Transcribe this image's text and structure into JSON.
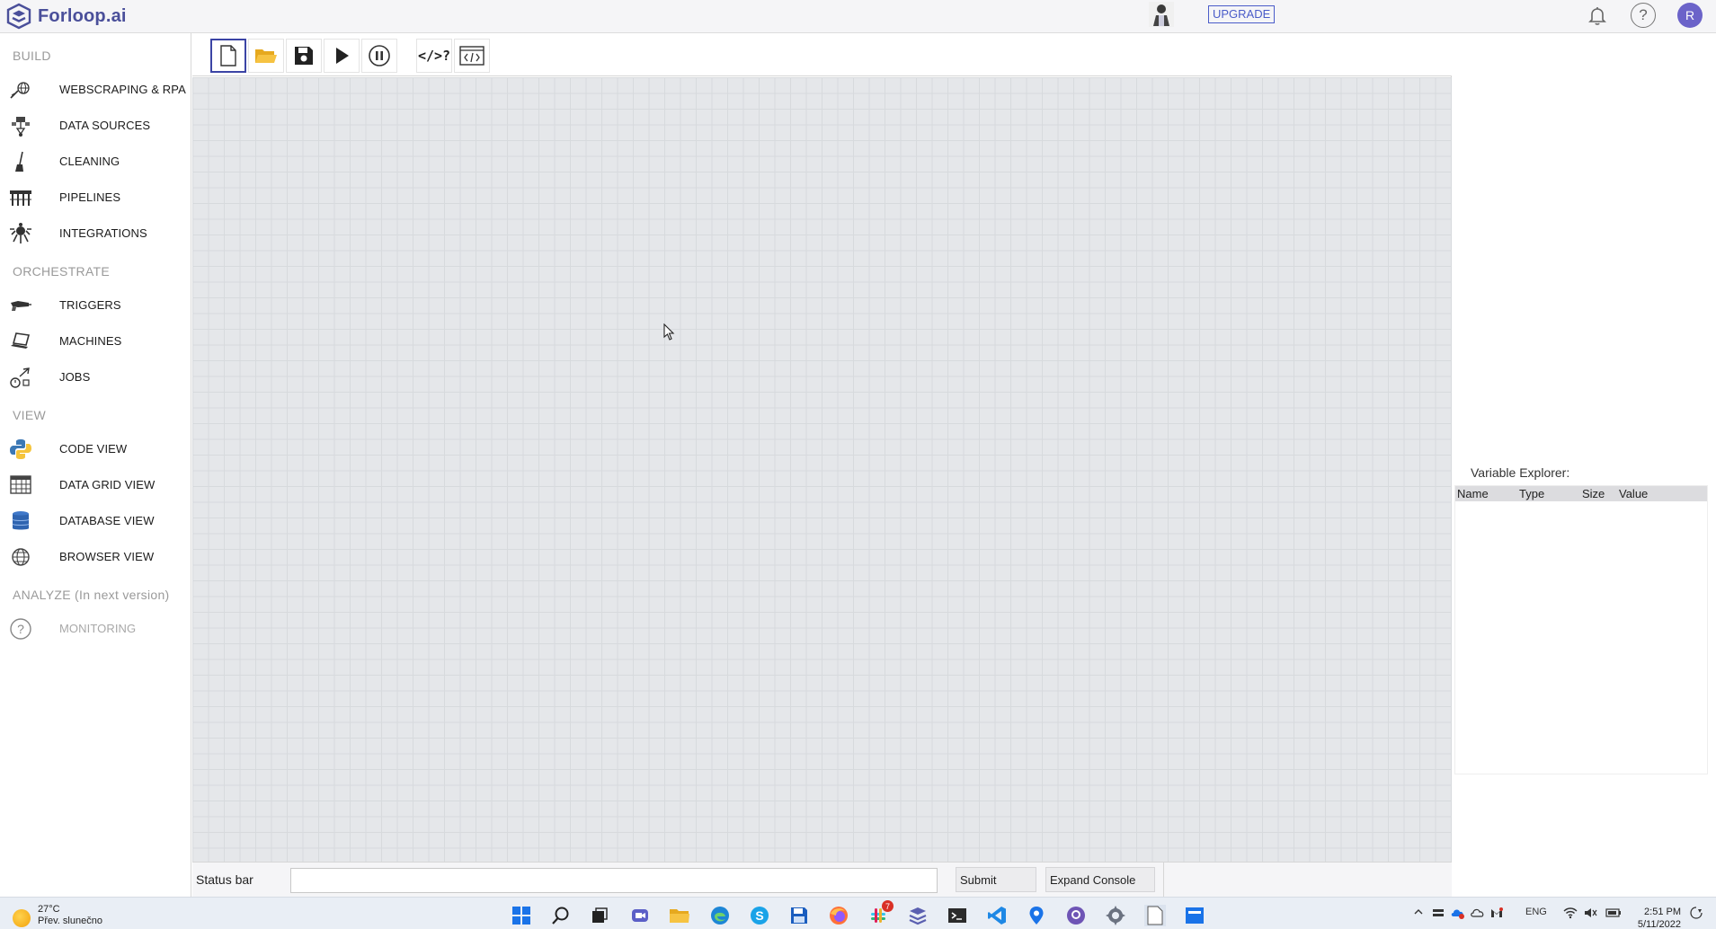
{
  "app": {
    "name": "Forloop.ai",
    "upgrade_label": "UPGRADE",
    "user_initial": "R"
  },
  "sidebar": {
    "sections": [
      {
        "title": "BUILD",
        "items": [
          {
            "label": "WEBSCRAPING & RPA",
            "icon": "webscraping-icon"
          },
          {
            "label": "DATA SOURCES",
            "icon": "data-sources-icon"
          },
          {
            "label": "CLEANING",
            "icon": "broom-icon"
          },
          {
            "label": "PIPELINES",
            "icon": "pipelines-icon"
          },
          {
            "label": "INTEGRATIONS",
            "icon": "integrations-icon"
          }
        ]
      },
      {
        "title": "ORCHESTRATE",
        "items": [
          {
            "label": "TRIGGERS",
            "icon": "trigger-icon"
          },
          {
            "label": "MACHINES",
            "icon": "laptop-icon"
          },
          {
            "label": "JOBS",
            "icon": "jobs-icon"
          }
        ]
      },
      {
        "title": "VIEW",
        "items": [
          {
            "label": "CODE VIEW",
            "icon": "python-icon"
          },
          {
            "label": "DATA GRID VIEW",
            "icon": "grid-icon"
          },
          {
            "label": "DATABASE VIEW",
            "icon": "database-icon"
          },
          {
            "label": "BROWSER VIEW",
            "icon": "globe-icon"
          }
        ]
      },
      {
        "title": "ANALYZE (In next version)",
        "items": [
          {
            "label": "MONITORING",
            "icon": "question-icon"
          }
        ]
      }
    ]
  },
  "toolbar": {
    "buttons": [
      {
        "name": "new-file",
        "icon": "new-file-icon",
        "active": true
      },
      {
        "name": "open-folder",
        "icon": "folder-icon"
      },
      {
        "name": "save",
        "icon": "floppy-icon"
      },
      {
        "name": "run",
        "icon": "play-icon"
      },
      {
        "name": "pause",
        "icon": "pause-icon"
      },
      {
        "name": "code-help",
        "icon": "code-question-icon",
        "glyph": "</>?"
      },
      {
        "name": "code-window",
        "icon": "code-window-icon"
      }
    ]
  },
  "statusbar": {
    "label": "Status bar",
    "input_value": "",
    "submit_label": "Submit",
    "expand_console_label": "Expand Console"
  },
  "variable_explorer": {
    "title": "Variable Explorer:",
    "columns": [
      "Name",
      "Type",
      "Size",
      "Value"
    ],
    "rows": []
  },
  "taskbar": {
    "weather_temp": "27°C",
    "weather_desc": "Přev. slunečno",
    "apps": [
      "windows-start-icon",
      "search-icon",
      "task-view-icon",
      "teams-icon",
      "file-explorer-icon",
      "edge-icon",
      "skype-icon",
      "save-app-icon",
      "firefox-icon",
      "slack-icon",
      "forloop-icon",
      "terminal-icon",
      "vscode-icon",
      "maps-icon",
      "github-icon",
      "settings-icon",
      "notepad-icon",
      "app-window-icon"
    ],
    "slack_badge": "7",
    "language": "ENG",
    "time": "2:51 PM",
    "date": "5/11/2022"
  },
  "colors": {
    "brand": "#4a4f9a",
    "accent": "#3b44a5",
    "canvas_bg": "#e5e7ea",
    "grid_line": "#d7dadd"
  }
}
